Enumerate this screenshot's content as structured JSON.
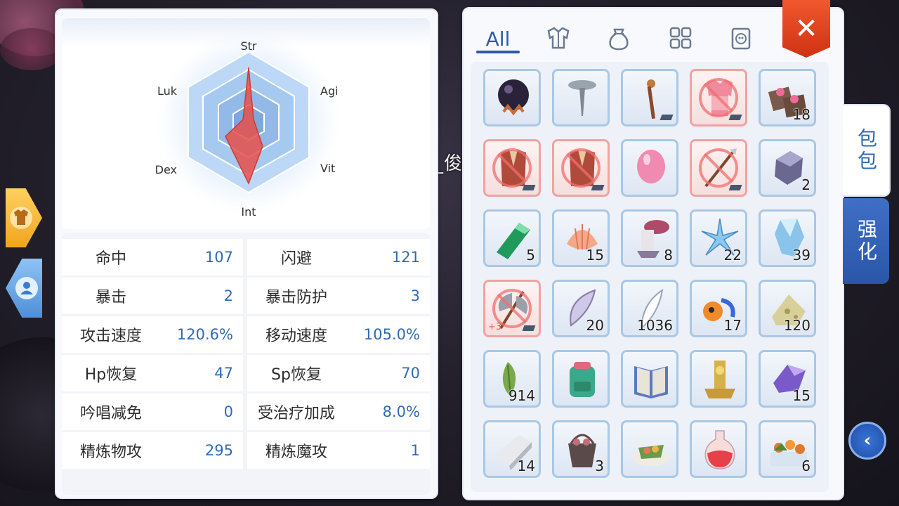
{
  "background": {
    "player_name": "_俊"
  },
  "radar": {
    "labels": [
      "Str",
      "Agi",
      "Vit",
      "Int",
      "Dex",
      "Luk"
    ]
  },
  "stats": [
    {
      "name": "命中",
      "value": "107"
    },
    {
      "name": "闪避",
      "value": "121"
    },
    {
      "name": "暴击",
      "value": "2"
    },
    {
      "name": "暴击防护",
      "value": "3"
    },
    {
      "name": "攻击速度",
      "value": "120.6%"
    },
    {
      "name": "移动速度",
      "value": "105.0%"
    },
    {
      "name": "Hp恢复",
      "value": "47"
    },
    {
      "name": "Sp恢复",
      "value": "70"
    },
    {
      "name": "吟唱减免",
      "value": "0"
    },
    {
      "name": "受治疗加成",
      "value": "8.0%"
    },
    {
      "name": "精炼物攻",
      "value": "295"
    },
    {
      "name": "精炼魔攻",
      "value": "1"
    }
  ],
  "inventory": {
    "tabs": {
      "all_label": "All",
      "icons": [
        "armor-icon",
        "potion-bag-icon",
        "grid-icon",
        "card-icon"
      ]
    },
    "close_label": "✕",
    "side_tabs": {
      "bag": "包包",
      "enhance": "强化"
    },
    "slots": [
      {
        "item": "dark-orb",
        "qty": ""
      },
      {
        "item": "nail",
        "qty": ""
      },
      {
        "item": "staff",
        "qty": ""
      },
      {
        "item": "pink-armor",
        "qty": ""
      },
      {
        "item": "cake",
        "qty": "18"
      },
      {
        "item": "red-coat",
        "qty": ""
      },
      {
        "item": "red-coat",
        "qty": ""
      },
      {
        "item": "pink-balloon",
        "qty": ""
      },
      {
        "item": "spear",
        "qty": ""
      },
      {
        "item": "purple-ore",
        "qty": "2"
      },
      {
        "item": "emerald",
        "qty": "5"
      },
      {
        "item": "shell",
        "qty": "15"
      },
      {
        "item": "mushroom-stump",
        "qty": "8"
      },
      {
        "item": "ice-crystal",
        "qty": "22"
      },
      {
        "item": "blue-crystal",
        "qty": "39"
      },
      {
        "item": "axe",
        "qty": "",
        "refine": "+3"
      },
      {
        "item": "wing",
        "qty": "20"
      },
      {
        "item": "feather",
        "qty": "1036"
      },
      {
        "item": "orange-device",
        "qty": "17"
      },
      {
        "item": "cheese",
        "qty": "120"
      },
      {
        "item": "leaf",
        "qty": "914"
      },
      {
        "item": "backpack",
        "qty": ""
      },
      {
        "item": "book",
        "qty": ""
      },
      {
        "item": "gold-statue",
        "qty": ""
      },
      {
        "item": "amethyst",
        "qty": "15"
      },
      {
        "item": "stone-slab",
        "qty": "14"
      },
      {
        "item": "basket",
        "qty": "3"
      },
      {
        "item": "food-plate",
        "qty": ""
      },
      {
        "item": "red-potion",
        "qty": ""
      },
      {
        "item": "flower-bed",
        "qty": "6"
      }
    ]
  },
  "colors": {
    "accent": "#2e5aa6",
    "close": "#e64a22",
    "value_blue": "#2f6ab5"
  }
}
